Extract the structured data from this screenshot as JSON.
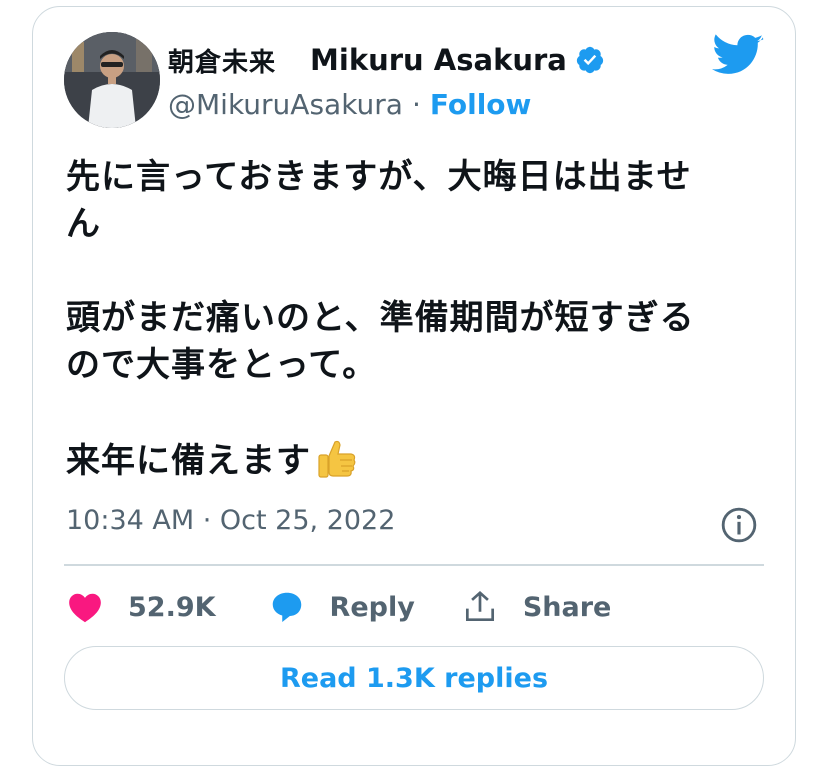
{
  "tweet": {
    "author_name_jp": "朝倉未来",
    "author_name_en": "Mikuru Asakura",
    "handle": "@MikuruAsakura",
    "separator": "·",
    "follow_label": "Follow",
    "verified_icon": "verified-badge-icon",
    "platform_icon": "twitter-bird-icon",
    "text_lines": [
      "先に言っておきますが、大晦日は出ませ",
      "ん",
      "頭がまだ痛いのと、準備期間が短すぎる",
      "ので大事をとって。",
      "来年に備えます"
    ],
    "emoji": "thumbs-up-emoji",
    "timestamp": "10:34 AM · Oct 25, 2022",
    "info_icon": "info-icon"
  },
  "actions": {
    "likes_count": "52.9K",
    "reply_label": "Reply",
    "share_label": "Share"
  },
  "read_replies_label": "Read 1.3K replies",
  "colors": {
    "accent": "#1d9bf0",
    "like": "#f91880",
    "muted": "#536471",
    "border": "#cfd9de"
  }
}
